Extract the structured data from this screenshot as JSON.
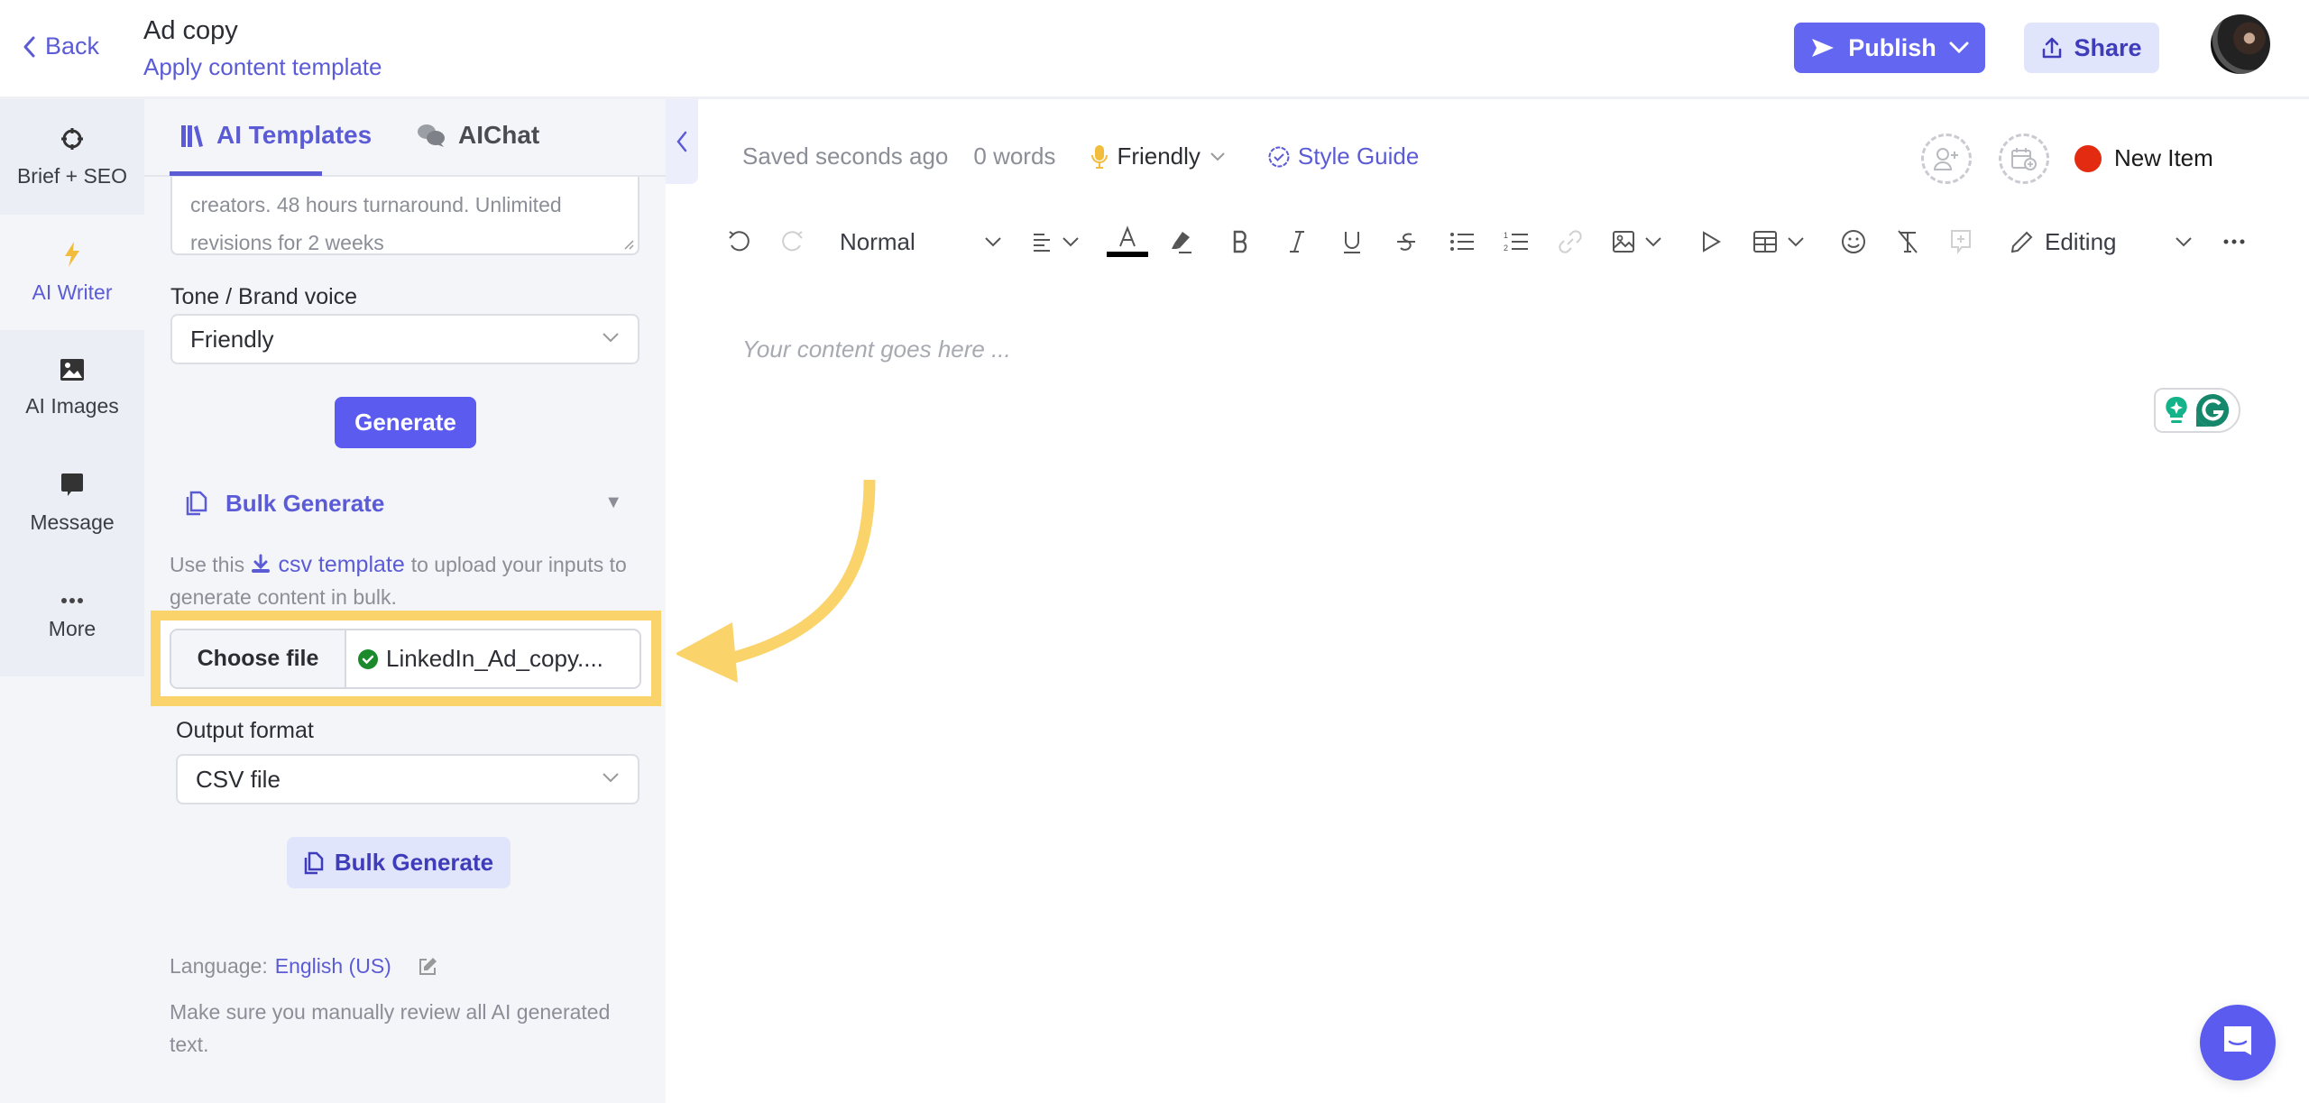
{
  "header": {
    "back_label": "Back",
    "title": "Ad copy",
    "subtitle_link": "Apply content template",
    "publish_label": "Publish",
    "share_label": "Share"
  },
  "rail": {
    "items": [
      {
        "label": "Brief + SEO",
        "icon": "crosshair-icon"
      },
      {
        "label": "AI Writer",
        "icon": "lightning-icon",
        "active": true
      },
      {
        "label": "AI Images",
        "icon": "image-icon"
      },
      {
        "label": "Message",
        "icon": "message-icon"
      },
      {
        "label": "More",
        "icon": "more-icon"
      }
    ]
  },
  "panel": {
    "tabs": [
      {
        "label": "AI Templates",
        "active": true
      },
      {
        "label": "AIChat",
        "active": false
      }
    ],
    "textarea_lines": [
      "creators. 48 hours turnaround. Unlimited",
      "revisions for 2 weeks"
    ],
    "tone_label": "Tone / Brand voice",
    "tone_value": "Friendly",
    "generate_label": "Generate",
    "bulk_header": "Bulk Generate",
    "help_prefix": "Use this",
    "help_link": "csv template",
    "help_suffix": "to upload your inputs to generate content in bulk.",
    "choose_file_label": "Choose file",
    "file_name": "LinkedIn_Ad_copy....",
    "output_label": "Output format",
    "output_value": "CSV file",
    "bulk_button_label": "Bulk Generate",
    "language_label": "Language:",
    "language_value": "English (US)",
    "disclaimer": "Make sure you manually review all AI generated text."
  },
  "editor": {
    "saved": "Saved seconds ago",
    "words": "0 words",
    "tone": "Friendly",
    "style_guide": "Style Guide",
    "status_label": "New Item",
    "status_color": "#e32b12",
    "toolbar": {
      "block_style": "Normal",
      "mode": "Editing",
      "text_color": "#000000"
    },
    "placeholder": "Your content goes here ..."
  },
  "colors": {
    "accent": "#5b5bd6",
    "primary_button": "#6366f1",
    "highlight": "#fbd36b"
  }
}
